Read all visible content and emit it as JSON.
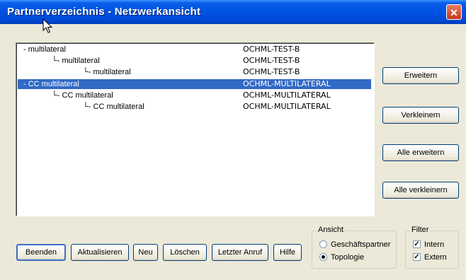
{
  "window": {
    "title": "Partnerverzeichnis - Netzwerkansicht",
    "close_glyph": "✕"
  },
  "tree": {
    "rows": [
      {
        "name": "- multilateral",
        "id": "OCHML-TEST-B",
        "selected": false
      },
      {
        "name": "└- multilateral",
        "id": "OCHML-TEST-B",
        "selected": false
      },
      {
        "name": "└- multilateral",
        "id": "OCHML-TEST-B",
        "selected": false
      },
      {
        "name": "- CC multilateral",
        "id": "OCHML-MULTILATERAL",
        "selected": true
      },
      {
        "name": "└- CC multilateral",
        "id": "OCHML-MULTILATERAL",
        "selected": false
      },
      {
        "name": "└- CC multilateral",
        "id": "OCHML-MULTILATERAL",
        "selected": false
      }
    ]
  },
  "side_buttons": {
    "expand": "Erweitern",
    "shrink": "Verkleinern",
    "expand_all": "Alle erweitern",
    "shrink_all": "Alle verkleinern"
  },
  "bottom_buttons": {
    "quit": "Beenden",
    "refresh": "Aktualisieren",
    "new": "Neu",
    "delete": "Löschen",
    "last_call": "Letzter Anruf",
    "help": "Hilfe"
  },
  "view_group": {
    "label": "Ansicht",
    "option_partner": "Geschäftspartner",
    "option_topology": "Topologie",
    "selected": "Topologie"
  },
  "filter_group": {
    "label": "Filter",
    "intern": "Intern",
    "extern": "Extern",
    "intern_checked": true,
    "extern_checked": true
  },
  "colors": {
    "title_bar": "#0054e3",
    "selection": "#316ac5",
    "dialog_bg": "#ece9d8"
  }
}
